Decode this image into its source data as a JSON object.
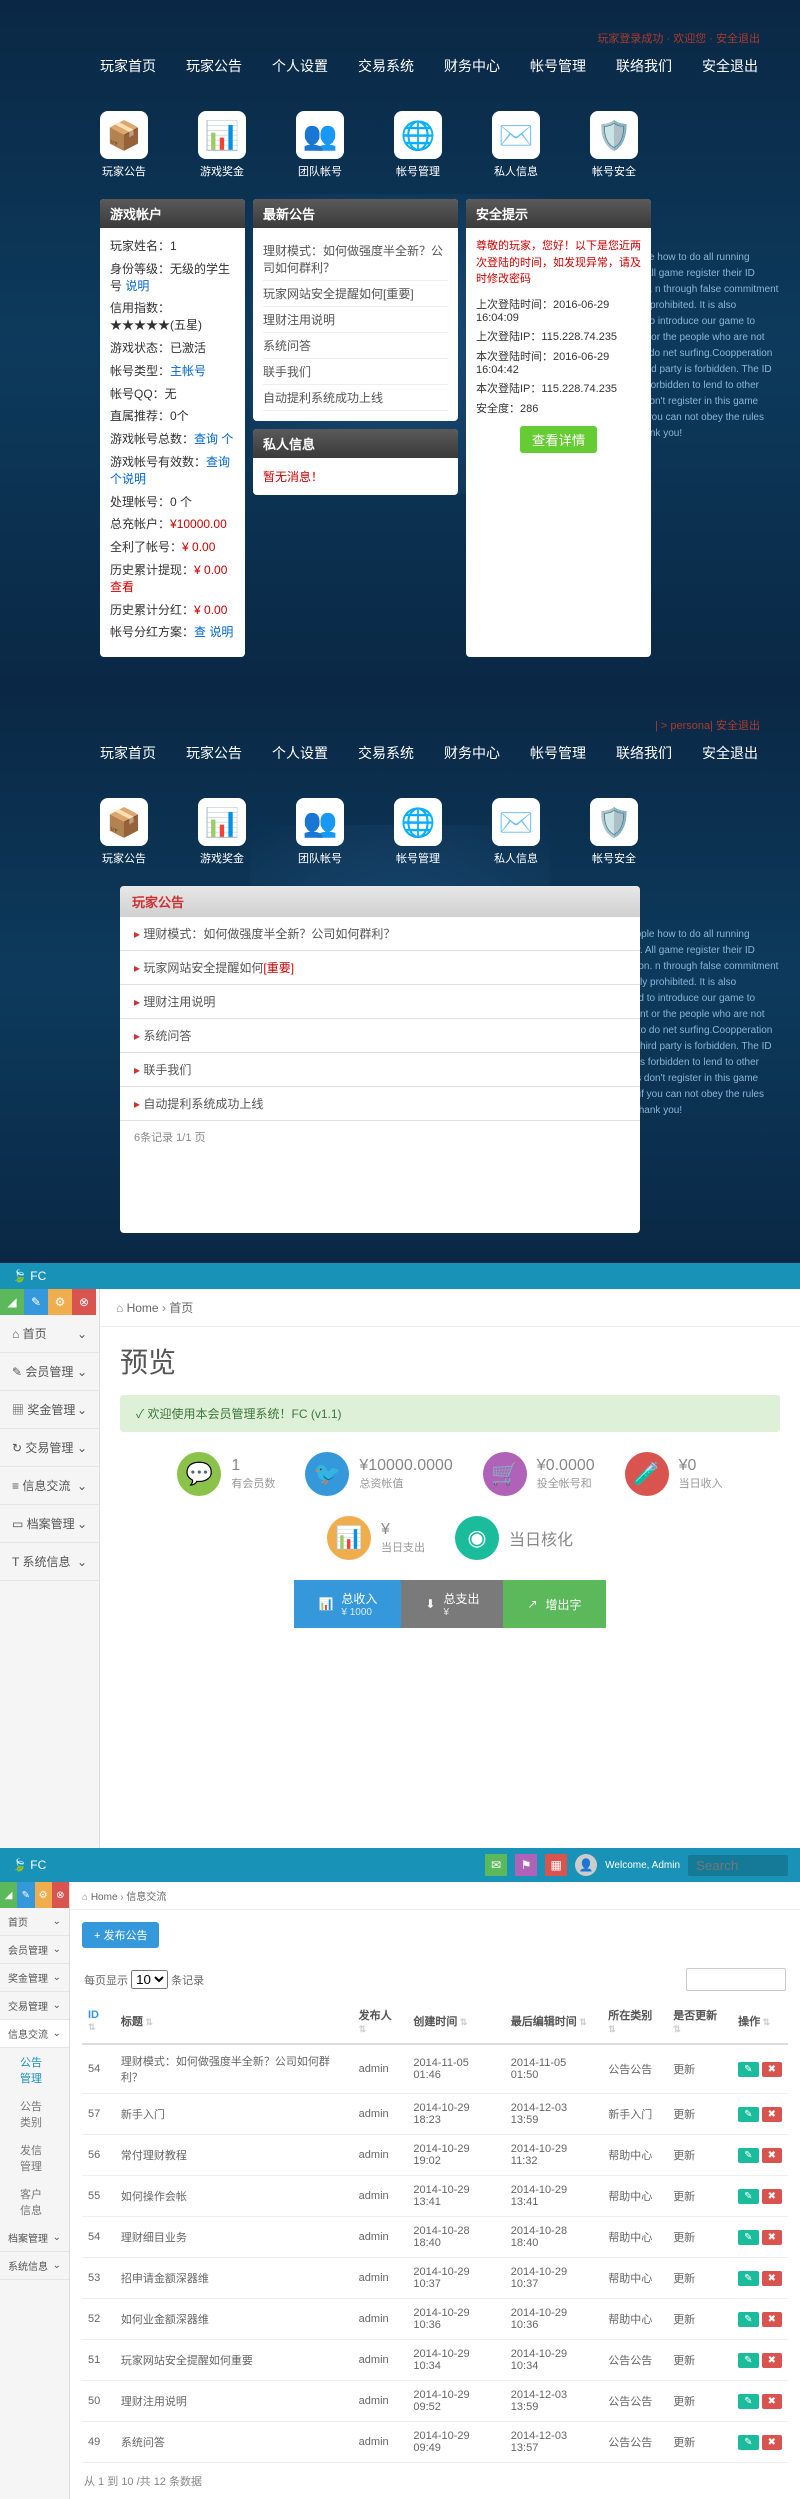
{
  "section1": {
    "top_status": "玩家登录成功 · 欢迎您 · 安全退出",
    "nav": [
      "玩家首页",
      "玩家公告",
      "个人设置",
      "交易系统",
      "财务中心",
      "帐号管理",
      "联络我们",
      "安全退出"
    ],
    "icons": [
      {
        "label": "玩家公告",
        "glyph": "📦",
        "bg": "#fff"
      },
      {
        "label": "游戏奖金",
        "glyph": "📊",
        "bg": "#fff"
      },
      {
        "label": "团队帐号",
        "glyph": "👥",
        "bg": "#fff"
      },
      {
        "label": "帐号管理",
        "glyph": "🌐",
        "bg": "#fff"
      },
      {
        "label": "私人信息",
        "glyph": "✉️",
        "bg": "#fff"
      },
      {
        "label": "帐号安全",
        "glyph": "🛡️",
        "bg": "#fff"
      }
    ],
    "account": {
      "title": "游戏帐户",
      "lines": [
        {
          "k": "玩家姓名：",
          "v": "1"
        },
        {
          "k": "身份等级：无级的学生号 ",
          "v": "说明",
          "blue": true
        },
        {
          "k": "信用指数：",
          "v": "★★★★★(五星)"
        },
        {
          "k": "游戏状态：",
          "v": "已激活"
        },
        {
          "k": "帐号类型：",
          "v": "主帐号",
          "blue": true
        },
        {
          "k": "帐号QQ：",
          "v": "无"
        },
        {
          "k": "直属推荐：",
          "v": "0个"
        },
        {
          "k": "游戏帐号总数：",
          "v": "查询 个",
          "blue": true
        },
        {
          "k": "游戏帐号有效数：",
          "v": "查询 个说明",
          "blue": true
        },
        {
          "k": "处理帐号：",
          "v": "0 个"
        },
        {
          "k": "总充帐户：",
          "v": "¥10000.00",
          "red": true
        },
        {
          "k": "全利了帐号：",
          "v": "¥ 0.00",
          "red": true
        },
        {
          "k": "历史累计提现：",
          "v": "¥ 0.00 查看",
          "red": true
        },
        {
          "k": "历史累计分红：",
          "v": "¥ 0.00",
          "red": true
        },
        {
          "k": "帐号分红方案：",
          "v": "查 说明",
          "blue": true
        }
      ]
    },
    "announce": {
      "title": "最新公告",
      "items": [
        "理财模式：如何做强度半全新？公司如何群利？",
        "玩家网站安全提醒如何[重要]",
        "理财注用说明",
        "系统问答",
        "联手我们",
        "自动提利系统成功上线"
      ]
    },
    "privmsg": {
      "title": "私人信息",
      "text": "暂无消息！"
    },
    "security": {
      "title": "安全提示",
      "warn": "尊敬的玩家，您好！以下是您近两次登陆的时间，如发现异常，请及时修改密码",
      "lines": [
        {
          "k": "上次登陆时间：",
          "v": "2016-06-29 16:04:09"
        },
        {
          "k": "上次登陆IP：",
          "v": "115.228.74.235"
        },
        {
          "k": "本次登陆时间：",
          "v": "2016-06-29 16:04:42"
        },
        {
          "k": "本次登陆IP：",
          "v": "115.228.74.235"
        },
        {
          "k": "安全度：",
          "v": "286"
        }
      ],
      "btn": "查看详情"
    },
    "english": "each people how to do all running company. All game register their ID information. n through false commitment is severely prohibited. It is also prohibited to introduce our game to adolescent or the people who are not capable to do net surfing.Coopperation with the third party is forbidden. The ID account is forbidden to lend to other users.Pls don't register in this game platform if you can not obey the rules above. Thank you!"
  },
  "section2": {
    "top_status": "| > persona| 安全退出",
    "alc_title": "玩家公告",
    "rows": [
      "理财模式：如何做强度半全新？公司如何群利？",
      "玩家网站安全提醒如何[重要]",
      "理财注用说明",
      "系统问答",
      "联手我们",
      "自动提利系统成功上线"
    ],
    "pager": "6条记录 1/1 页"
  },
  "section3": {
    "brand": "FC",
    "color_tabs": [
      "◢",
      "✎",
      "⚙",
      "⊗"
    ],
    "sidebar": [
      {
        "icon": "⌂",
        "label": "首页"
      },
      {
        "icon": "✎",
        "label": "会员管理"
      },
      {
        "icon": "▦",
        "label": "奖金管理"
      },
      {
        "icon": "↻",
        "label": "交易管理"
      },
      {
        "icon": "≡",
        "label": "信息交流"
      },
      {
        "icon": "▭",
        "label": "档案管理"
      },
      {
        "icon": "T",
        "label": "系统信息"
      }
    ],
    "breadcrumb": [
      "Home",
      "首页"
    ],
    "page_title": "预览",
    "welcome": "✓ 欢迎使用本会员管理系统！FC (v1.1)",
    "stats_row1": [
      {
        "icon": "💬",
        "cls": "si-green",
        "num": "1",
        "lab": "有会员数"
      },
      {
        "icon": "🐦",
        "cls": "si-blue",
        "num": "¥10000.0000",
        "lab": "总资帐值"
      },
      {
        "icon": "🛒",
        "cls": "si-purple",
        "num": "¥0.0000",
        "lab": "投全帐号和"
      },
      {
        "icon": "🧪",
        "cls": "si-red",
        "num": "¥0",
        "lab": "当日收入"
      }
    ],
    "stats_row2": [
      {
        "icon": "📊",
        "cls": "si-orange",
        "num": "¥",
        "lab": "当日支出"
      },
      {
        "icon": "◉",
        "cls": "si-teal",
        "num": "当日核化",
        "lab": ""
      }
    ],
    "actions": [
      {
        "cls": "ab1",
        "icon": "📊",
        "label": "总收入",
        "sub": "¥ 1000"
      },
      {
        "cls": "ab2",
        "icon": "⬇",
        "label": "总支出",
        "sub": "¥"
      },
      {
        "cls": "ab3",
        "icon": "↗",
        "label": "增出字",
        "sub": ""
      }
    ]
  },
  "section4": {
    "brand": "FC",
    "welcome_user": "Welcome, Admin",
    "search_placeholder": "Search",
    "breadcrumb": [
      "Home",
      "信息交流"
    ],
    "sidebar": [
      {
        "label": "首页"
      },
      {
        "label": "会员管理"
      },
      {
        "label": "奖金管理"
      },
      {
        "label": "交易管理"
      },
      {
        "label": "信息交流",
        "active": true
      },
      {
        "label": "公告管理",
        "sub": true,
        "active": true
      },
      {
        "label": "公告类别",
        "sub": true
      },
      {
        "label": "发信管理",
        "sub": true
      },
      {
        "label": "客户信息",
        "sub": true
      },
      {
        "label": "档案管理"
      },
      {
        "label": "系统信息"
      }
    ],
    "add_btn": "+ 发布公告",
    "per_page_label": "每页显示",
    "per_page_value": "10",
    "per_page_suffix": "条记录",
    "columns": [
      "ID",
      "标题",
      "发布人",
      "创建时间",
      "最后编辑时间",
      "所在类别",
      "是否更新",
      "操作"
    ],
    "rows": [
      {
        "id": "54",
        "title": "理财模式：如何做强度半全新？公司如何群利？",
        "author": "admin",
        "created": "2014-11-05 01:46",
        "edited": "2014-11-05 01:50",
        "cat": "公告公告",
        "upd": "更新"
      },
      {
        "id": "57",
        "title": "新手入门",
        "author": "admin",
        "created": "2014-10-29 18:23",
        "edited": "2014-12-03 13:59",
        "cat": "新手入门",
        "upd": "更新"
      },
      {
        "id": "56",
        "title": "常付理财教程",
        "author": "admin",
        "created": "2014-10-29 19:02",
        "edited": "2014-10-29 11:32",
        "cat": "帮助中心",
        "upd": "更新"
      },
      {
        "id": "55",
        "title": "如何操作会帐",
        "author": "admin",
        "created": "2014-10-29 13:41",
        "edited": "2014-10-29 13:41",
        "cat": "帮助中心",
        "upd": "更新"
      },
      {
        "id": "54",
        "title": "理财细目业务",
        "author": "admin",
        "created": "2014-10-28 18:40",
        "edited": "2014-10-28 18:40",
        "cat": "帮助中心",
        "upd": "更新"
      },
      {
        "id": "53",
        "title": "招申请金额深器维",
        "author": "admin",
        "created": "2014-10-29 10:37",
        "edited": "2014-10-29 10:37",
        "cat": "帮助中心",
        "upd": "更新"
      },
      {
        "id": "52",
        "title": "如何业金额深器维",
        "author": "admin",
        "created": "2014-10-29 10:36",
        "edited": "2014-10-29 10:36",
        "cat": "帮助中心",
        "upd": "更新"
      },
      {
        "id": "51",
        "title": "玩家网站安全提醒如何重要",
        "author": "admin",
        "created": "2014-10-29 10:34",
        "edited": "2014-10-29 10:34",
        "cat": "公告公告",
        "upd": "更新"
      },
      {
        "id": "50",
        "title": "理财注用说明",
        "author": "admin",
        "created": "2014-10-29 09:52",
        "edited": "2014-12-03 13:59",
        "cat": "公告公告",
        "upd": "更新"
      },
      {
        "id": "49",
        "title": "系统问答",
        "author": "admin",
        "created": "2014-10-29 09:49",
        "edited": "2014-12-03 13:57",
        "cat": "公告公告",
        "upd": "更新"
      }
    ],
    "footer": "从 1 到 10 /共 12 条数据"
  }
}
